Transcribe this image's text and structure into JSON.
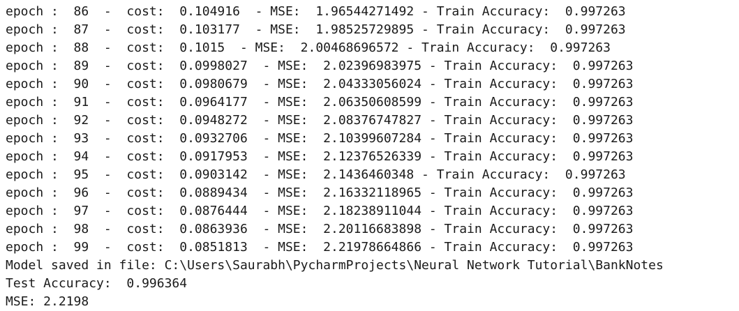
{
  "console": {
    "lines": [
      "epoch :  86  -  cost:  0.104916  - MSE:  1.96544271492 - Train Accuracy:  0.997263",
      "epoch :  87  -  cost:  0.103177  - MSE:  1.98525729895 - Train Accuracy:  0.997263",
      "epoch :  88  -  cost:  0.1015  - MSE:  2.00468696572 - Train Accuracy:  0.997263",
      "epoch :  89  -  cost:  0.0998027  - MSE:  2.02396983975 - Train Accuracy:  0.997263",
      "epoch :  90  -  cost:  0.0980679  - MSE:  2.04333056024 - Train Accuracy:  0.997263",
      "epoch :  91  -  cost:  0.0964177  - MSE:  2.06350608599 - Train Accuracy:  0.997263",
      "epoch :  92  -  cost:  0.0948272  - MSE:  2.08376747827 - Train Accuracy:  0.997263",
      "epoch :  93  -  cost:  0.0932706  - MSE:  2.10399607284 - Train Accuracy:  0.997263",
      "epoch :  94  -  cost:  0.0917953  - MSE:  2.12376526339 - Train Accuracy:  0.997263",
      "epoch :  95  -  cost:  0.0903142  - MSE:  2.1436460348 - Train Accuracy:  0.997263",
      "epoch :  96  -  cost:  0.0889434  - MSE:  2.16332118965 - Train Accuracy:  0.997263",
      "epoch :  97  -  cost:  0.0876444  - MSE:  2.18238911044 - Train Accuracy:  0.997263",
      "epoch :  98  -  cost:  0.0863936  - MSE:  2.20116683898 - Train Accuracy:  0.997263",
      "epoch :  99  -  cost:  0.0851813  - MSE:  2.21978664866 - Train Accuracy:  0.997263",
      "Model saved in file: C:\\Users\\Saurabh\\PycharmProjects\\Neural Network Tutorial\\BankNotes",
      "Test Accuracy:  0.996364",
      "MSE: 2.2198"
    ]
  },
  "colors": {
    "background": "#ffffff",
    "text": "#1a1a1a"
  }
}
